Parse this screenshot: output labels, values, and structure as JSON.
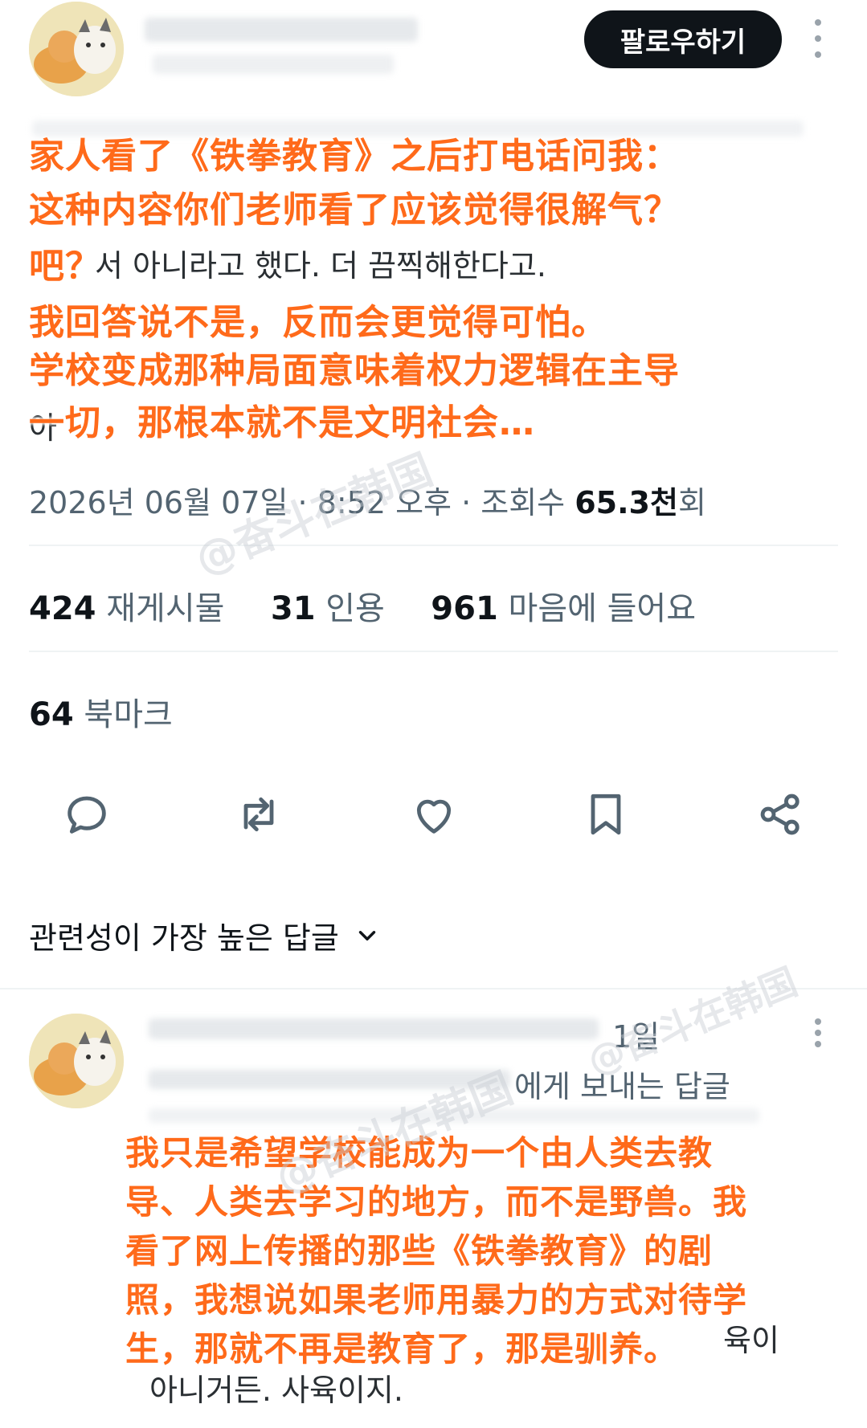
{
  "header": {
    "follow_label": "팔로우하기",
    "more_icon": "more-vertical-icon"
  },
  "post": {
    "korean_partial": {
      "line3": "서 아니라고 했다. 더 끔찍해한다고.",
      "line7": "아"
    },
    "overlay_cn": {
      "line1": "家人看了《铁拳教育》之后打电话问我：",
      "line2": "这种内容你们老师看了应该觉得很解气？",
      "line3": "吧？",
      "line4": "我回答说不是，反而会更觉得可怕。",
      "line5": "学校变成那种局面意味着权力逻辑在主导",
      "line6": "一切，那根本就不是文明社会…"
    },
    "timestamp": "2026년 06월 07일 · 8:52 오후 · 조회수",
    "views_value": "65.3천",
    "views_suffix": "회"
  },
  "stats": {
    "reposts_count": "424",
    "reposts_label": "재게시물",
    "quotes_count": "31",
    "quotes_label": "인용",
    "likes_count": "961",
    "likes_label": "마음에 들어요",
    "bookmarks_count": "64",
    "bookmarks_label": "북마크"
  },
  "actions": [
    "reply-icon",
    "repost-icon",
    "like-icon",
    "bookmark-icon",
    "share-icon"
  ],
  "replies_sort": {
    "label": "관련성이 가장 높은 답글"
  },
  "reply": {
    "time_partial": "1일",
    "reply_to_partial": "에게 보내는 답글",
    "korean_partial": {
      "line6_end": "육이",
      "line7": "아니거든. 사육이지."
    },
    "overlay_cn": {
      "line1": "我只是希望学校能成为一个由人类去教",
      "line2": "导、人类去学习的地方，而不是野兽。我",
      "line3": "看了网上传播的那些《铁拳教育》的剧",
      "line4": "照，我想说如果老师用暴力的方式对待学",
      "line5": "生，那就不再是教育了，那是驯养。"
    }
  },
  "watermark": "@奋斗在韩国",
  "colors": {
    "overlay_text": "#ff6a1a",
    "follow_button_bg": "#0f1419",
    "secondary_text": "#536471"
  }
}
